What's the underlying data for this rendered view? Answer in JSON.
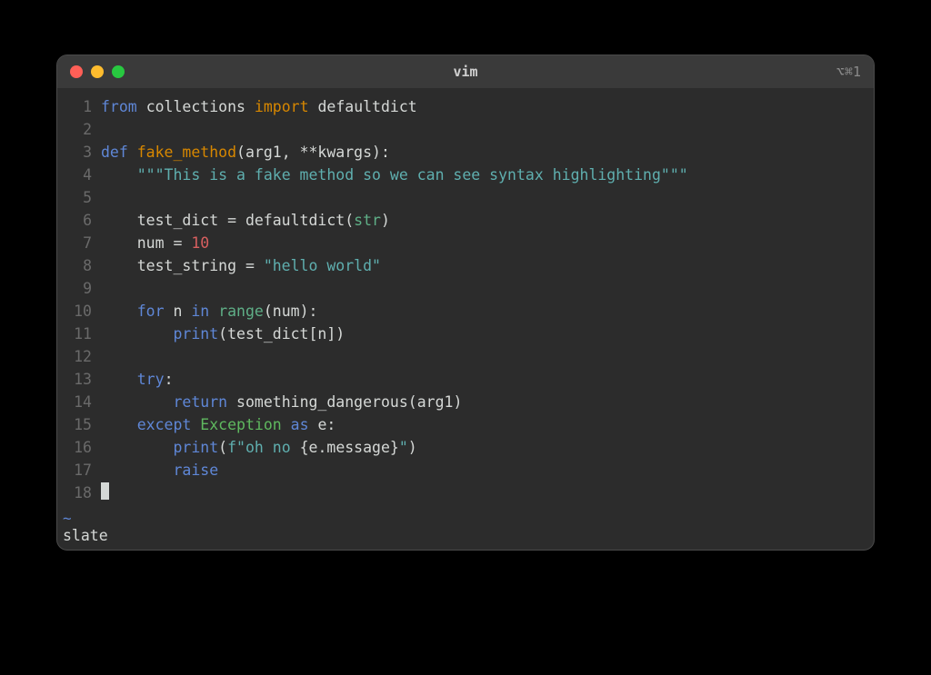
{
  "titlebar": {
    "title": "vim",
    "right_indicator": "⌥⌘1"
  },
  "lines": [
    {
      "n": "1",
      "tokens": [
        [
          "kw",
          "from"
        ],
        [
          "punc",
          " "
        ],
        [
          "code",
          "collections"
        ],
        [
          "punc",
          " "
        ],
        [
          "incl",
          "import"
        ],
        [
          "punc",
          " "
        ],
        [
          "code",
          "defaultdict"
        ]
      ]
    },
    {
      "n": "2",
      "tokens": []
    },
    {
      "n": "3",
      "tokens": [
        [
          "kw",
          "def"
        ],
        [
          "punc",
          " "
        ],
        [
          "def",
          "fake_method"
        ],
        [
          "punc",
          "(arg1, **kwargs):"
        ]
      ]
    },
    {
      "n": "4",
      "tokens": [
        [
          "punc",
          "    "
        ],
        [
          "str",
          "\"\"\"This is a fake method so we can see syntax highlighting\"\"\""
        ]
      ]
    },
    {
      "n": "5",
      "tokens": []
    },
    {
      "n": "6",
      "tokens": [
        [
          "punc",
          "    test_dict = defaultdict("
        ],
        [
          "builtin",
          "str"
        ],
        [
          "punc",
          ")"
        ]
      ]
    },
    {
      "n": "7",
      "tokens": [
        [
          "punc",
          "    num = "
        ],
        [
          "num",
          "10"
        ]
      ]
    },
    {
      "n": "8",
      "tokens": [
        [
          "punc",
          "    test_string = "
        ],
        [
          "str",
          "\"hello world\""
        ]
      ]
    },
    {
      "n": "9",
      "tokens": []
    },
    {
      "n": "10",
      "tokens": [
        [
          "punc",
          "    "
        ],
        [
          "kw",
          "for"
        ],
        [
          "punc",
          " n "
        ],
        [
          "kw",
          "in"
        ],
        [
          "punc",
          " "
        ],
        [
          "builtin",
          "range"
        ],
        [
          "punc",
          "(num):"
        ]
      ]
    },
    {
      "n": "11",
      "tokens": [
        [
          "punc",
          "        "
        ],
        [
          "kw",
          "print"
        ],
        [
          "punc",
          "(test_dict[n])"
        ]
      ]
    },
    {
      "n": "12",
      "tokens": []
    },
    {
      "n": "13",
      "tokens": [
        [
          "punc",
          "    "
        ],
        [
          "kw",
          "try"
        ],
        [
          "punc",
          ":"
        ]
      ]
    },
    {
      "n": "14",
      "tokens": [
        [
          "punc",
          "        "
        ],
        [
          "kw",
          "return"
        ],
        [
          "punc",
          " something_dangerous(arg1)"
        ]
      ]
    },
    {
      "n": "15",
      "tokens": [
        [
          "punc",
          "    "
        ],
        [
          "kw",
          "except"
        ],
        [
          "punc",
          " "
        ],
        [
          "type",
          "Exception"
        ],
        [
          "punc",
          " "
        ],
        [
          "kw",
          "as"
        ],
        [
          "punc",
          " e:"
        ]
      ]
    },
    {
      "n": "16",
      "tokens": [
        [
          "punc",
          "        "
        ],
        [
          "kw",
          "print"
        ],
        [
          "punc",
          "("
        ],
        [
          "str",
          "f\"oh no "
        ],
        [
          "punc",
          "{e.message}"
        ],
        [
          "str",
          "\""
        ],
        [
          "punc",
          ")"
        ]
      ]
    },
    {
      "n": "17",
      "tokens": [
        [
          "punc",
          "        "
        ],
        [
          "kw",
          "raise"
        ]
      ]
    },
    {
      "n": "18",
      "tokens": [],
      "cursor": true
    }
  ],
  "tilde": "~",
  "status": "slate",
  "colors": {
    "background": "#2c2c2c",
    "foreground": "#d5d8d6",
    "gutter": "#6a6a6a",
    "keyword": "#5f87d7",
    "include": "#d78700",
    "string": "#5fafaf",
    "number": "#d75f5f",
    "type": "#5fb95f",
    "builtin": "#5faf87"
  }
}
